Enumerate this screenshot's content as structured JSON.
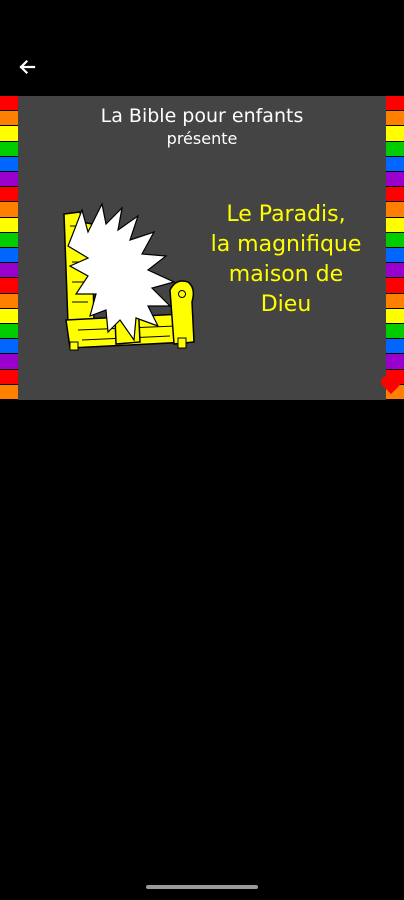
{
  "slide": {
    "series_title": "La Bible pour enfants",
    "series_subtitle": "présente",
    "story_title_lines": [
      "Le Paradis,",
      "la magnifique",
      "maison de",
      "Dieu"
    ]
  },
  "icons": {
    "back": "arrow-left-icon",
    "favorite": "heart-icon",
    "illustration": "throne-with-glory-rays"
  },
  "colors": {
    "background": "#000000",
    "panel": "#444444",
    "title_text": "#ffffff",
    "story_text": "#ffff00",
    "heart": "#ff0000",
    "rainbow": [
      "#ff0000",
      "#ff7f00",
      "#ffff00",
      "#00cc00",
      "#0066ff",
      "#9900cc"
    ]
  }
}
